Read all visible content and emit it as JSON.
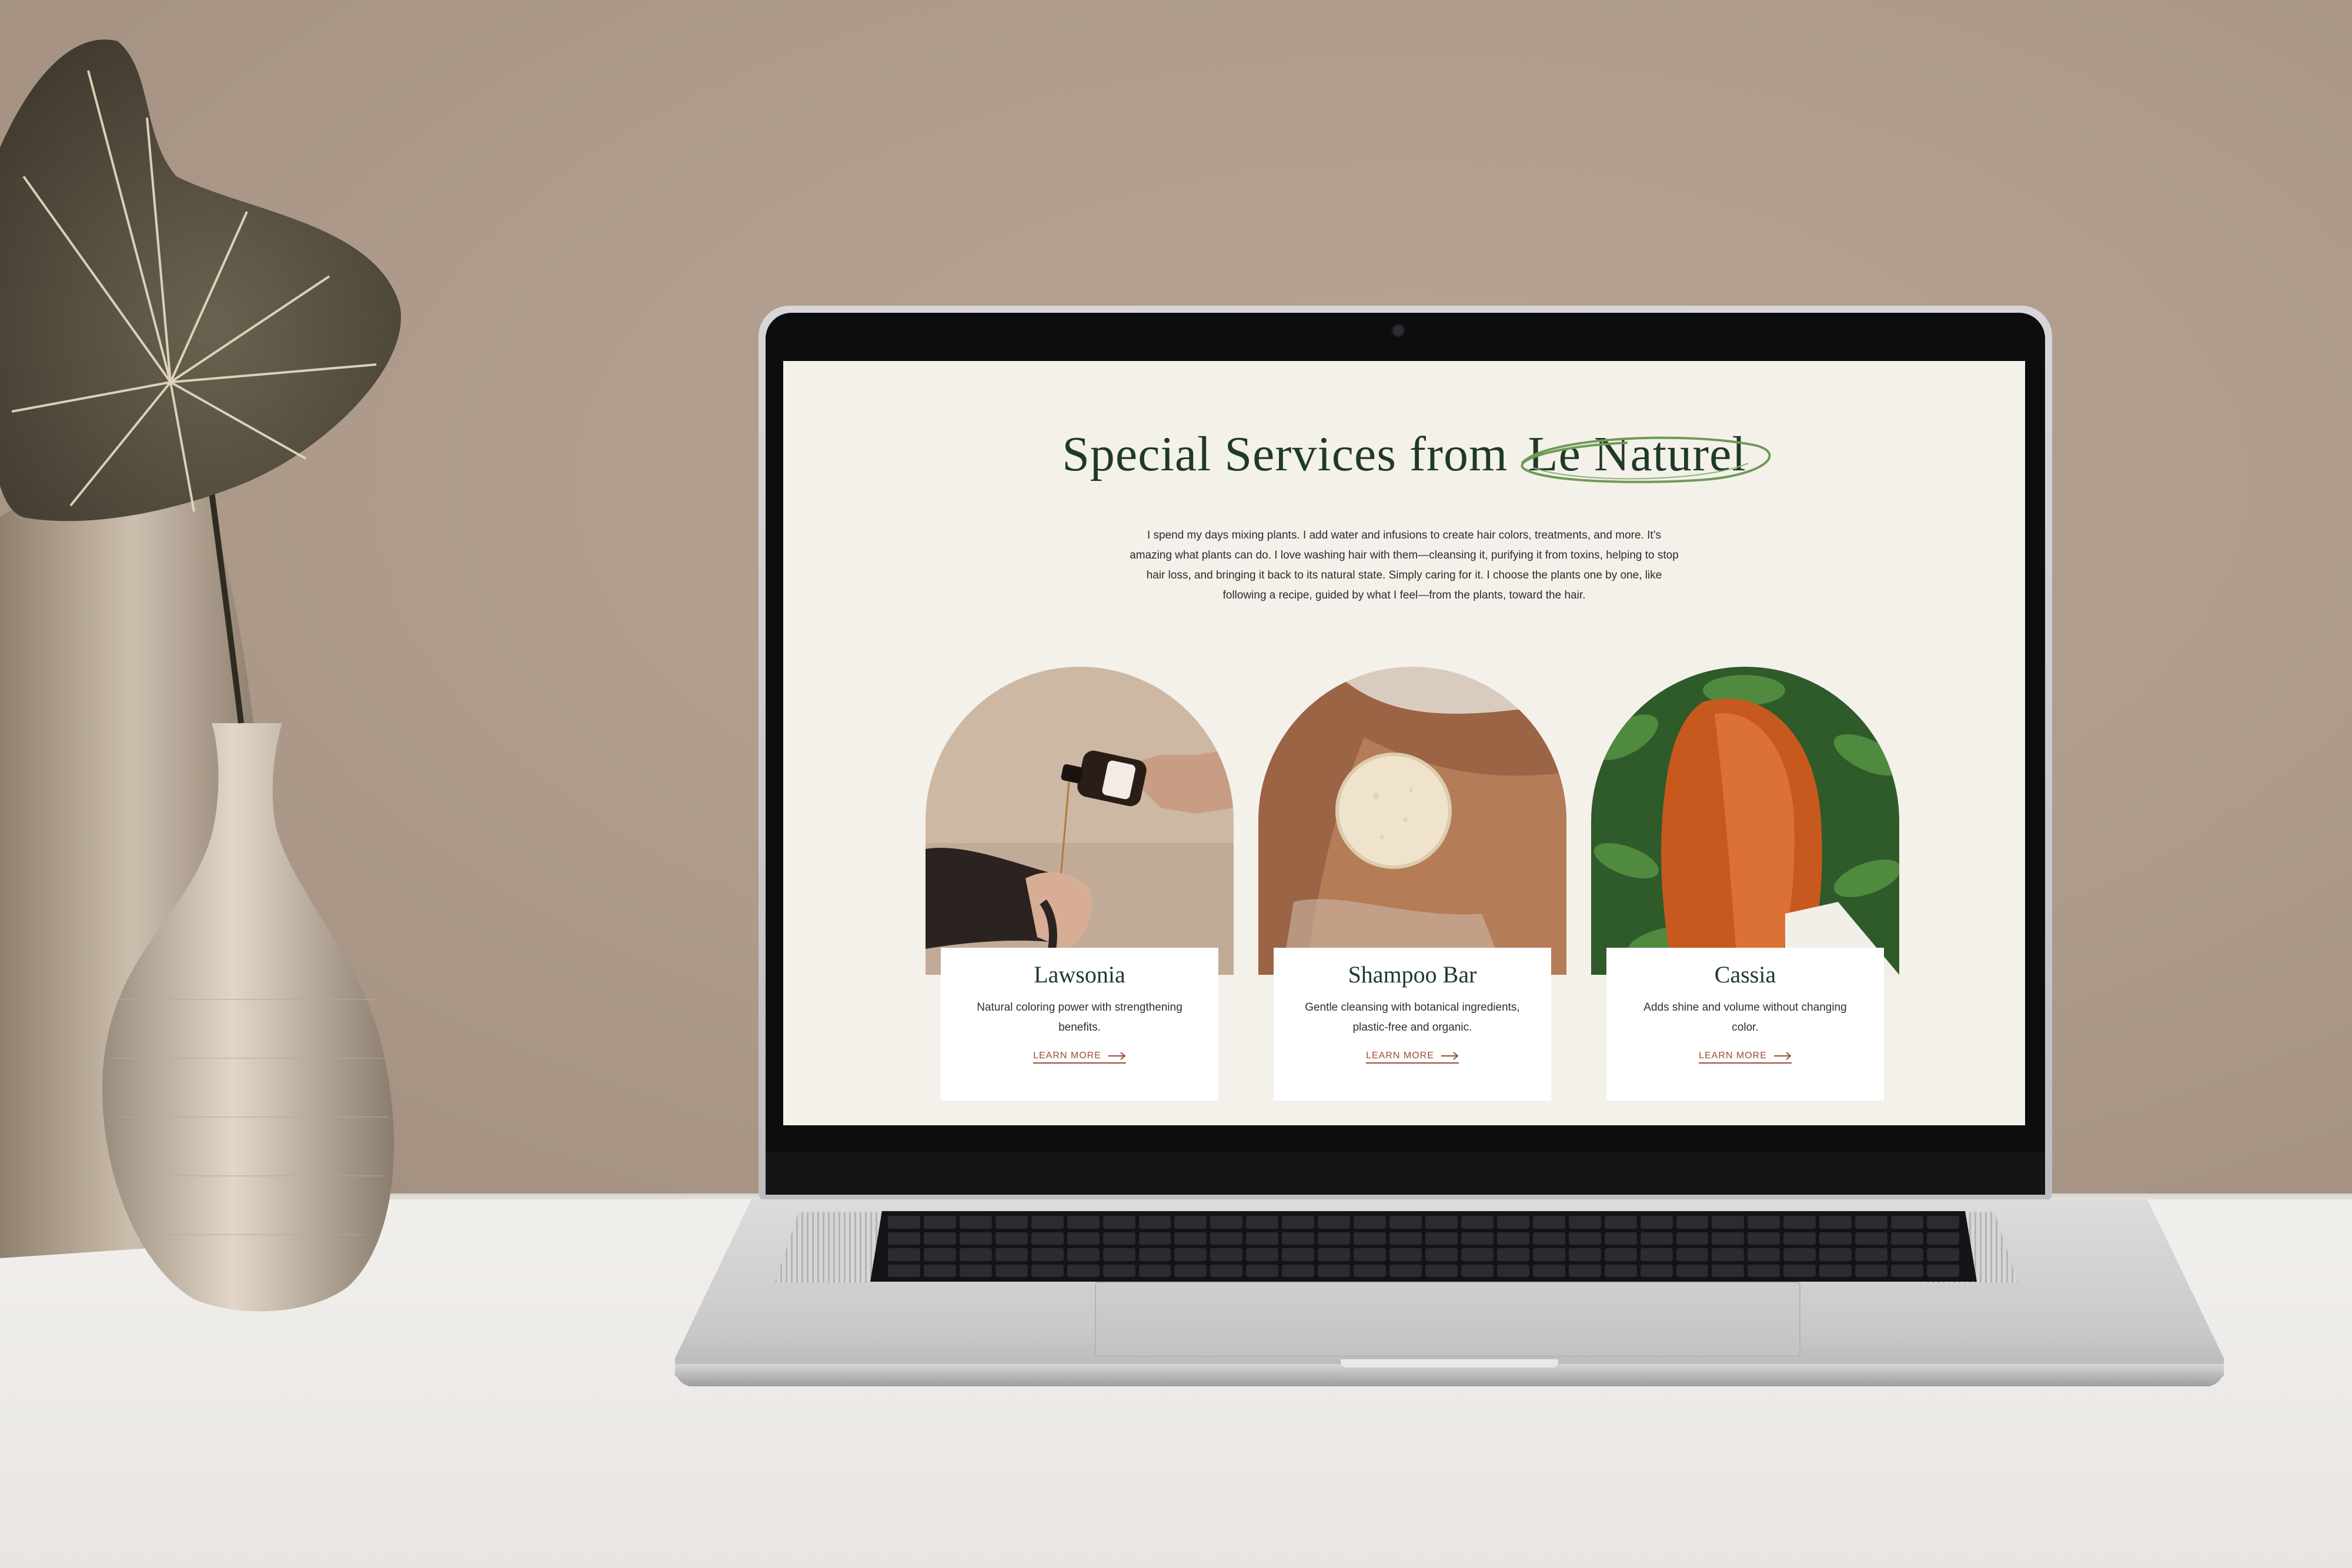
{
  "site": {
    "title_prefix": "Special Services from",
    "title_brand": "Le Naturel",
    "intro": "I spend my days mixing plants. I add water and infusions to create hair colors, treatments, and more. It’s amazing what plants can do. I love washing hair with them—cleansing it, purifying it from toxins, helping to stop hair loss, and bringing it back to its natural state. Simply caring for it. I choose the plants one by one, like following a recipe, guided by what I feel—from the plants, toward the hair.",
    "cards": [
      {
        "title": "Lawsonia",
        "description": "Natural coloring power with strengthening benefits.",
        "link": "LEARN MORE",
        "image_icon": "hair-oil-pour-photo"
      },
      {
        "title": "Shampoo Bar",
        "description": "Gentle cleansing with botanical ingredients, plastic-free and organic.",
        "link": "LEARN MORE",
        "image_icon": "shampoo-bar-photo"
      },
      {
        "title": "Cassia",
        "description": "Adds shine and volume without changing color.",
        "link": "LEARN MORE",
        "image_icon": "red-hair-leaves-photo"
      }
    ]
  },
  "colors": {
    "screen_bg": "#f4f1eb",
    "heading": "#1f3a26",
    "link": "#9a4a34",
    "swirl": "#6f9a55"
  }
}
